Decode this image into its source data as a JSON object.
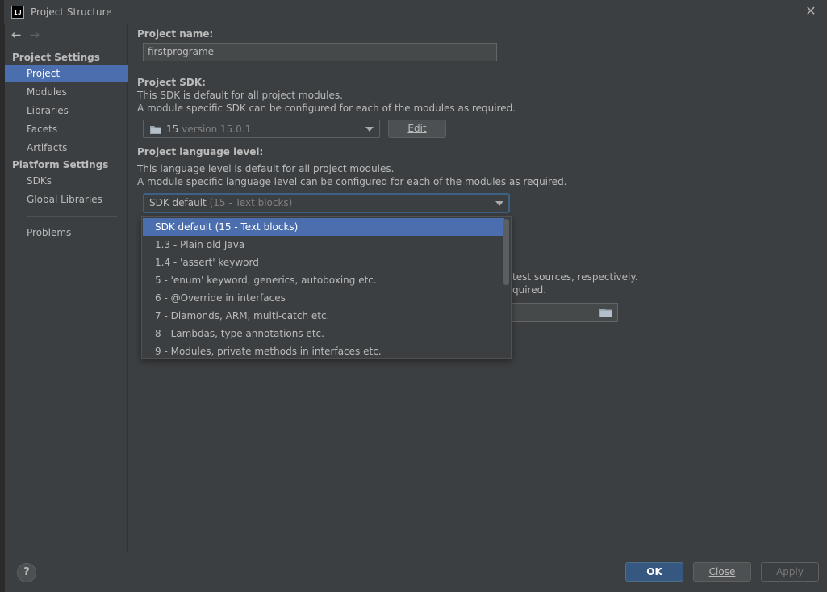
{
  "window": {
    "title": "Project Structure",
    "logo_text": "IJ"
  },
  "nav": {
    "back_icon": "arrow-left-icon",
    "forward_icon": "arrow-right-icon"
  },
  "sidebar": {
    "project_settings_header": "Project Settings",
    "project_settings_items": [
      "Project",
      "Modules",
      "Libraries",
      "Facets",
      "Artifacts"
    ],
    "platform_settings_header": "Platform Settings",
    "platform_settings_items": [
      "SDKs",
      "Global Libraries"
    ],
    "problems": "Problems",
    "selected": "Project"
  },
  "main": {
    "project_name_label": "Project name:",
    "project_name_value": "firstprograme",
    "sdk_label": "Project SDK:",
    "sdk_help_1": "This SDK is default for all project modules.",
    "sdk_help_2": "A module specific SDK can be configured for each of the modules as required.",
    "sdk_value": "15",
    "sdk_version": "version 15.0.1",
    "edit_button": "Edit",
    "lang_label": "Project language level:",
    "lang_help_1": "This language level is default for all project modules.",
    "lang_help_2": "A module specific language level can be configured for each of the modules as required.",
    "lang_value_main": "SDK default",
    "lang_value_sub": "(15 - Text blocks)",
    "bg_fragment_1": "test sources, respectively.",
    "bg_fragment_2": "quired."
  },
  "lang_dropdown": {
    "options": [
      "SDK default (15 - Text blocks)",
      "1.3 - Plain old Java",
      "1.4 - 'assert' keyword",
      "5 - 'enum' keyword, generics, autoboxing etc.",
      "6 - @Override in interfaces",
      "7 - Diamonds, ARM, multi-catch etc.",
      "8 - Lambdas, type annotations etc.",
      "9 - Modules, private methods in interfaces etc."
    ],
    "selected_index": 0
  },
  "buttons": {
    "help": "?",
    "ok": "OK",
    "close": "Close",
    "apply": "Apply"
  },
  "colors": {
    "selection": "#4b6eaf",
    "background": "#3c3f41",
    "ok_button": "#365880"
  }
}
